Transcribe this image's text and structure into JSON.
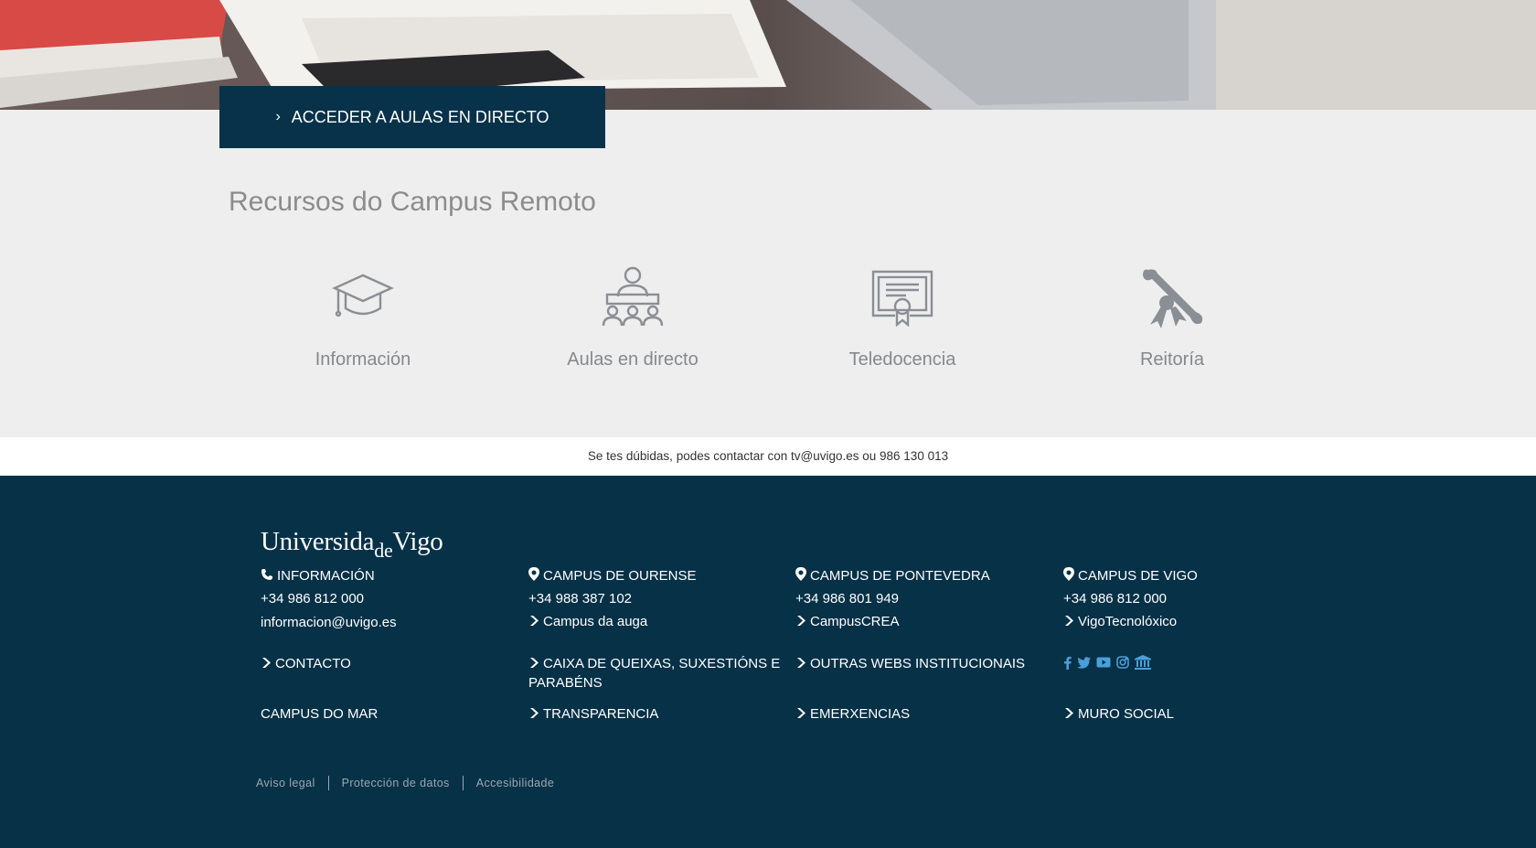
{
  "hero": {
    "button_label": "ACCEDER A AULAS EN DIRECTO",
    "button_icon": "chevron-right-icon"
  },
  "resources": {
    "title": "Recursos do Campus Remoto",
    "items": [
      {
        "label": "Información",
        "icon": "graduation-cap-icon"
      },
      {
        "label": "Aulas en directo",
        "icon": "classroom-icon"
      },
      {
        "label": "Teledocencia",
        "icon": "certificate-icon"
      },
      {
        "label": "Reitoría",
        "icon": "diploma-icon"
      }
    ]
  },
  "contact_bar": {
    "text": "Se tes dúbidas, podes contactar con tv@uvigo.es ou 986 130 013"
  },
  "footer": {
    "logo": "Universidade Vigo",
    "info": {
      "title": "INFORMACIÓN",
      "phone": "+34 986 812 000",
      "email": "informacion@uvigo.es"
    },
    "ourense": {
      "title": "CAMPUS DE OURENSE",
      "phone": "+34 988 387 102",
      "link": "Campus da auga"
    },
    "pontevedra": {
      "title": "CAMPUS DE PONTEVEDRA",
      "phone": "+34 986 801 949",
      "link": "CampusCREA"
    },
    "vigo": {
      "title": "CAMPUS DE VIGO",
      "phone": "+34 986 812 000",
      "link": "VigoTecnolóxico"
    },
    "contacto": "CONTACTO",
    "caixa": "CAIXA DE QUEIXAS, SUXESTIÓNS E PARABÉNS",
    "outras": "OUTRAS WEBS INSTITUCIONAIS",
    "campus_mar": "CAMPUS DO MAR",
    "transparencia": "TRANSPARENCIA",
    "emerxencias": "EMERXENCIAS",
    "muro": "MURO SOCIAL",
    "social_icons": [
      "facebook-icon",
      "twitter-icon",
      "youtube-icon",
      "instagram-icon",
      "institution-icon"
    ],
    "legal": [
      "Aviso legal",
      "Protección de datos",
      "Accesibilidade"
    ]
  },
  "colors": {
    "dark_blue": "#073147",
    "button_blue": "#08324a",
    "icon_gray": "#8a8f95",
    "social_blue": "#4a9fd8"
  }
}
